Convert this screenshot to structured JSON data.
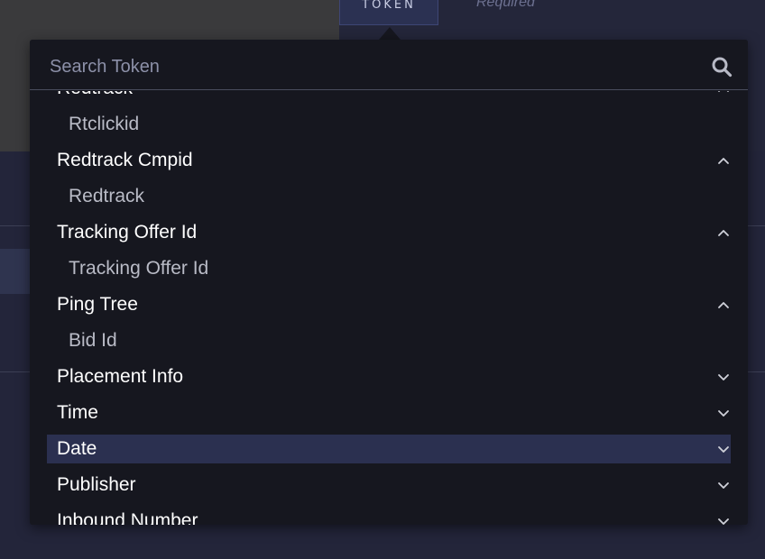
{
  "background": {
    "token_tab_label": "TOKEN",
    "required_label": "Required"
  },
  "search": {
    "placeholder": "Search Token",
    "value": ""
  },
  "groups": [
    {
      "label": "Redtrack",
      "expanded": true,
      "children": [
        "Rtclickid"
      ]
    },
    {
      "label": "Redtrack Cmpid",
      "expanded": true,
      "children": [
        "Redtrack"
      ]
    },
    {
      "label": "Tracking Offer Id",
      "expanded": true,
      "children": [
        "Tracking Offer Id"
      ]
    },
    {
      "label": "Ping Tree",
      "expanded": true,
      "children": [
        "Bid Id"
      ]
    },
    {
      "label": "Placement Info",
      "expanded": false,
      "children": []
    },
    {
      "label": "Time",
      "expanded": false,
      "children": []
    },
    {
      "label": "Date",
      "expanded": false,
      "highlighted": true,
      "children": []
    },
    {
      "label": "Publisher",
      "expanded": false,
      "children": []
    },
    {
      "label": "Inbound Number",
      "expanded": false,
      "children": []
    }
  ],
  "colors": {
    "accent_highlight": "#2b3050",
    "dropdown_bg": "#16171f",
    "text_primary": "#ffffff",
    "text_secondary": "#b9bbc6"
  },
  "icons": {
    "search": "search-icon",
    "expanded": "chevron-up-icon",
    "collapsed": "chevron-down-icon"
  }
}
